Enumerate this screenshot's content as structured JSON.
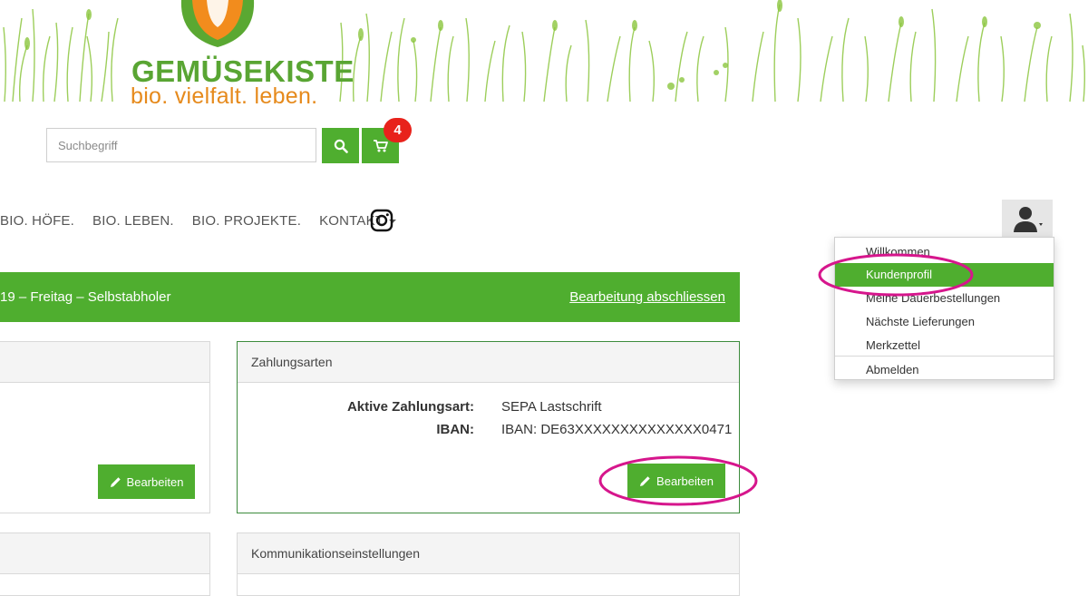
{
  "brand": {
    "name": "GEMÜSEKISTE",
    "tagline": "bio. vielfalt. leben."
  },
  "search": {
    "placeholder": "Suchbegriff"
  },
  "cart": {
    "count": "4"
  },
  "nav": {
    "items": [
      "BIO. HÖFE.",
      "BIO. LEBEN.",
      "BIO. PROJEKTE.",
      "KONTAKT"
    ]
  },
  "user_menu": {
    "items": [
      "Willkommen",
      "Kundenprofil",
      "Meine Dauerbestellungen",
      "Nächste Lieferungen",
      "Merkzettel",
      "Abmelden"
    ],
    "active": "Kundenprofil"
  },
  "delivery_bar": {
    "date_text": "19 – Freitag – Selbstabholer",
    "finish_label": "Bearbeitung abschliessen"
  },
  "payment": {
    "title": "Zahlungsarten",
    "active_label": "Aktive Zahlungsart:",
    "active_value": "SEPA Lastschrift",
    "iban_label": "IBAN:",
    "iban_value": "IBAN: DE63XXXXXXXXXXXXXX0471",
    "edit_label": "Bearbeiten"
  },
  "left_panel": {
    "edit_label": "Bearbeiten"
  },
  "communication": {
    "title": "Kommunikationseinstellungen"
  },
  "colors": {
    "accent": "#4fae2f",
    "badge": "#e8221b",
    "highlight": "#d6168c",
    "tagline": "#e68a1c"
  }
}
